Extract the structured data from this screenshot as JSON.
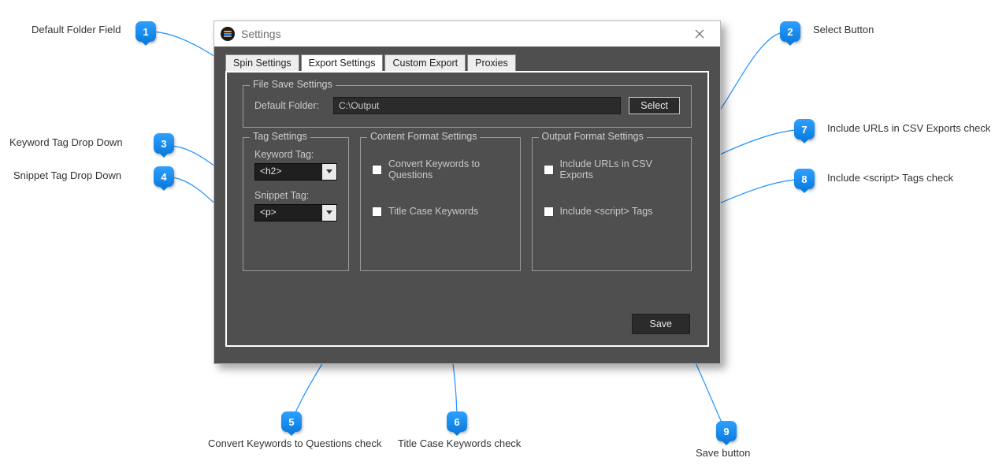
{
  "window": {
    "title": "Settings",
    "close_icon": "close-icon"
  },
  "tabs": {
    "spin": "Spin Settings",
    "export": "Export Settings",
    "custom": "Custom Export",
    "proxies": "Proxies"
  },
  "file_save": {
    "legend": "File Save Settings",
    "default_folder_label": "Default Folder:",
    "default_folder_value": "C:\\Output",
    "select_btn": "Select"
  },
  "tag_settings": {
    "legend": "Tag Settings",
    "keyword_label": "Keyword Tag:",
    "keyword_value": "<h2>",
    "snippet_label": "Snippet Tag:",
    "snippet_value": "<p>"
  },
  "content_format": {
    "legend": "Content Format Settings",
    "convert_label": "Convert Keywords to Questions",
    "titlecase_label": "Title Case Keywords"
  },
  "output_format": {
    "legend": "Output Format Settings",
    "include_urls_label": "Include URLs in CSV Exports",
    "include_script_label": "Include <script> Tags"
  },
  "save_btn": "Save",
  "callouts": {
    "1": {
      "num": "1",
      "text": "Default Folder Field"
    },
    "2": {
      "num": "2",
      "text": "Select Button"
    },
    "3": {
      "num": "3",
      "text": "Keyword Tag Drop Down"
    },
    "4": {
      "num": "4",
      "text": "Snippet Tag Drop Down"
    },
    "5": {
      "num": "5",
      "text": "Convert Keywords to Questions check"
    },
    "6": {
      "num": "6",
      "text": "Title Case Keywords check"
    },
    "7": {
      "num": "7",
      "text": "Include URLs in CSV Exports check"
    },
    "8": {
      "num": "8",
      "text": "Include <script> Tags check"
    },
    "9": {
      "num": "9",
      "text": "Save button"
    }
  }
}
